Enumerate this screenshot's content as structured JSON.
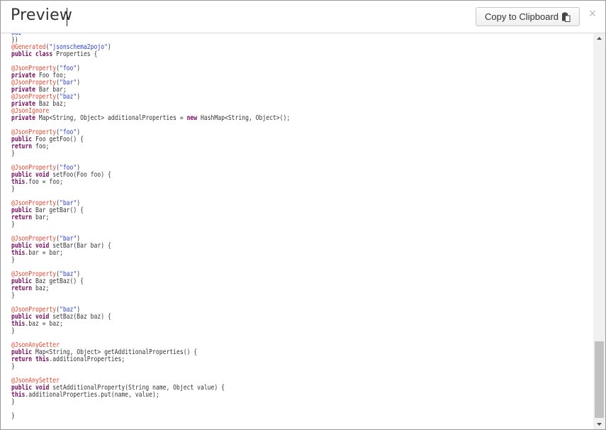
{
  "dialog": {
    "title": "Preview",
    "copy_label": "Copy to Clipboard",
    "close_symbol": "×"
  },
  "icons": {
    "copy": "clipboard-icon",
    "close": "close-icon",
    "scroll_up": "arrow-up-icon",
    "scroll_down": "arrow-down-icon"
  },
  "colors": {
    "keyword": "#7a0b5e",
    "annotation": "#e8452e",
    "string": "#2a3fd6",
    "plain": "#333333"
  },
  "code_lines": [
    [
      [
        "st",
        "baz"
      ]
    ],
    [
      [
        "pl",
        "})"
      ]
    ],
    [
      [
        "an",
        "@Generated"
      ],
      [
        "pl",
        "("
      ],
      [
        "st",
        "\"jsonschema2pojo\""
      ],
      [
        "pl",
        ")"
      ]
    ],
    [
      [
        "kw",
        "public class"
      ],
      [
        "pl",
        " Properties {"
      ]
    ],
    [],
    [
      [
        "an",
        "@JsonProperty"
      ],
      [
        "pl",
        "("
      ],
      [
        "st",
        "\"foo\""
      ],
      [
        "pl",
        ")"
      ]
    ],
    [
      [
        "kw",
        "private"
      ],
      [
        "pl",
        " Foo foo;"
      ]
    ],
    [
      [
        "an",
        "@JsonProperty"
      ],
      [
        "pl",
        "("
      ],
      [
        "st",
        "\"bar\""
      ],
      [
        "pl",
        ")"
      ]
    ],
    [
      [
        "kw",
        "private"
      ],
      [
        "pl",
        " Bar bar;"
      ]
    ],
    [
      [
        "an",
        "@JsonProperty"
      ],
      [
        "pl",
        "("
      ],
      [
        "st",
        "\"baz\""
      ],
      [
        "pl",
        ")"
      ]
    ],
    [
      [
        "kw",
        "private"
      ],
      [
        "pl",
        " Baz baz;"
      ]
    ],
    [
      [
        "an",
        "@JsonIgnore"
      ]
    ],
    [
      [
        "kw",
        "private"
      ],
      [
        "pl",
        " Map<String, Object> additionalProperties = "
      ],
      [
        "kw",
        "new"
      ],
      [
        "pl",
        " HashMap<String, Object>();"
      ]
    ],
    [],
    [
      [
        "an",
        "@JsonProperty"
      ],
      [
        "pl",
        "("
      ],
      [
        "st",
        "\"foo\""
      ],
      [
        "pl",
        ")"
      ]
    ],
    [
      [
        "kw",
        "public"
      ],
      [
        "pl",
        " Foo getFoo() {"
      ]
    ],
    [
      [
        "kw",
        "return"
      ],
      [
        "pl",
        " foo;"
      ]
    ],
    [
      [
        "pl",
        "}"
      ]
    ],
    [],
    [
      [
        "an",
        "@JsonProperty"
      ],
      [
        "pl",
        "("
      ],
      [
        "st",
        "\"foo\""
      ],
      [
        "pl",
        ")"
      ]
    ],
    [
      [
        "kw",
        "public void"
      ],
      [
        "pl",
        " setFoo(Foo foo) {"
      ]
    ],
    [
      [
        "kw",
        "this"
      ],
      [
        "pl",
        ".foo = foo;"
      ]
    ],
    [
      [
        "pl",
        "}"
      ]
    ],
    [],
    [
      [
        "an",
        "@JsonProperty"
      ],
      [
        "pl",
        "("
      ],
      [
        "st",
        "\"bar\""
      ],
      [
        "pl",
        ")"
      ]
    ],
    [
      [
        "kw",
        "public"
      ],
      [
        "pl",
        " Bar getBar() {"
      ]
    ],
    [
      [
        "kw",
        "return"
      ],
      [
        "pl",
        " bar;"
      ]
    ],
    [
      [
        "pl",
        "}"
      ]
    ],
    [],
    [
      [
        "an",
        "@JsonProperty"
      ],
      [
        "pl",
        "("
      ],
      [
        "st",
        "\"bar\""
      ],
      [
        "pl",
        ")"
      ]
    ],
    [
      [
        "kw",
        "public void"
      ],
      [
        "pl",
        " setBar(Bar bar) {"
      ]
    ],
    [
      [
        "kw",
        "this"
      ],
      [
        "pl",
        ".bar = bar;"
      ]
    ],
    [
      [
        "pl",
        "}"
      ]
    ],
    [],
    [
      [
        "an",
        "@JsonProperty"
      ],
      [
        "pl",
        "("
      ],
      [
        "st",
        "\"baz\""
      ],
      [
        "pl",
        ")"
      ]
    ],
    [
      [
        "kw",
        "public"
      ],
      [
        "pl",
        " Baz getBaz() {"
      ]
    ],
    [
      [
        "kw",
        "return"
      ],
      [
        "pl",
        " baz;"
      ]
    ],
    [
      [
        "pl",
        "}"
      ]
    ],
    [],
    [
      [
        "an",
        "@JsonProperty"
      ],
      [
        "pl",
        "("
      ],
      [
        "st",
        "\"baz\""
      ],
      [
        "pl",
        ")"
      ]
    ],
    [
      [
        "kw",
        "public void"
      ],
      [
        "pl",
        " setBaz(Baz baz) {"
      ]
    ],
    [
      [
        "kw",
        "this"
      ],
      [
        "pl",
        ".baz = baz;"
      ]
    ],
    [
      [
        "pl",
        "}"
      ]
    ],
    [],
    [
      [
        "an",
        "@JsonAnyGetter"
      ]
    ],
    [
      [
        "kw",
        "public"
      ],
      [
        "pl",
        " Map<String, Object> getAdditionalProperties() {"
      ]
    ],
    [
      [
        "kw",
        "return this"
      ],
      [
        "pl",
        ".additionalProperties;"
      ]
    ],
    [
      [
        "pl",
        "}"
      ]
    ],
    [],
    [
      [
        "an",
        "@JsonAnySetter"
      ]
    ],
    [
      [
        "kw",
        "public void"
      ],
      [
        "pl",
        " setAdditionalProperty(String name, Object value) {"
      ]
    ],
    [
      [
        "kw",
        "this"
      ],
      [
        "pl",
        ".additionalProperties.put(name, value);"
      ]
    ],
    [
      [
        "pl",
        "}"
      ]
    ],
    [],
    [
      [
        "pl",
        "}"
      ]
    ]
  ]
}
